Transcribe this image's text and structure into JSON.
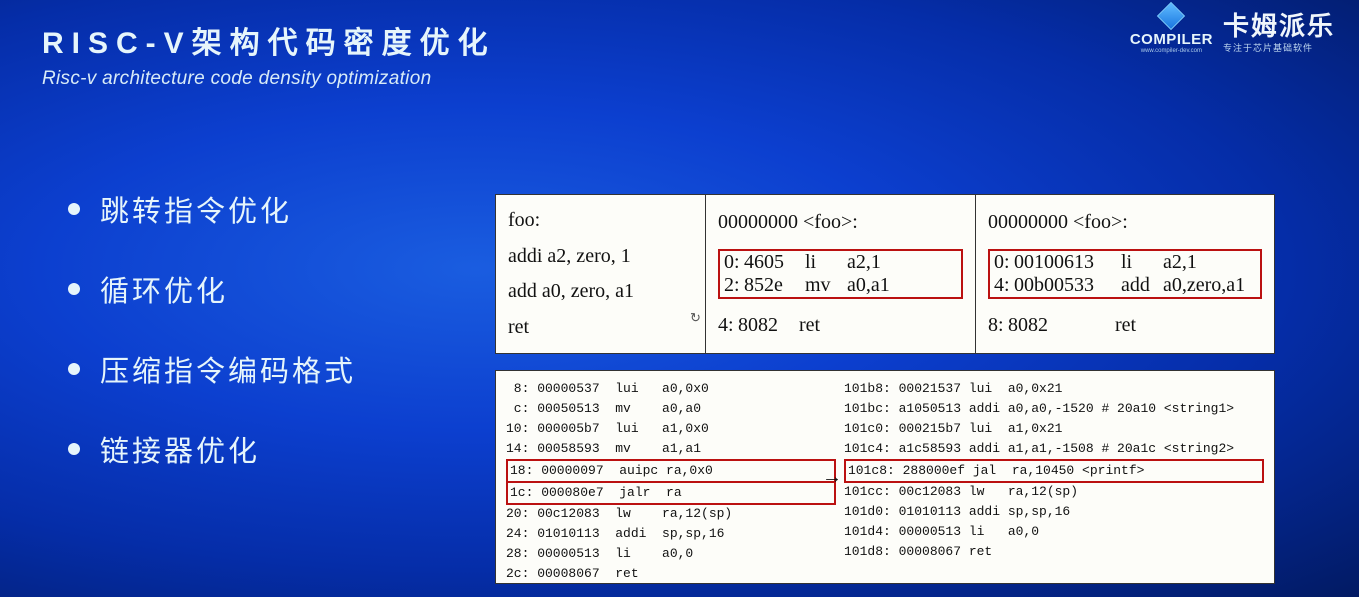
{
  "header": {
    "title_cn": "RISC-V架构代码密度优化",
    "title_en": "Risc-v architecture code density optimization"
  },
  "logo": {
    "compiler": "COMPILER",
    "compiler_sub": "www.compiler-dev.com",
    "brand": "卡姆派乐",
    "brand_sub": "专注于芯片基础软件"
  },
  "bullets": [
    "跳转指令优化",
    "循环优化",
    "压缩指令编码格式",
    "链接器优化"
  ],
  "panel1": {
    "col1": {
      "l1": "foo:",
      "l2": "addi a2, zero, 1",
      "l3": "add a0, zero, a1",
      "l4": "ret"
    },
    "col2": {
      "head": "00000000 <foo>:",
      "r1_addr": "0:",
      "r1_enc": "4605",
      "r1_mn": "li",
      "r1_ops": "a2,1",
      "r2_addr": "2:",
      "r2_enc": "852e",
      "r2_mn": "mv",
      "r2_ops": "a0,a1",
      "r3_addr": "4:",
      "r3_enc": "8082",
      "r3_mn": "ret",
      "r3_ops": ""
    },
    "col3": {
      "head": "00000000 <foo>:",
      "r1_addr": "0:",
      "r1_enc": "00100613",
      "r1_mn": "li",
      "r1_ops": "a2,1",
      "r2_addr": "4:",
      "r2_enc": "00b00533",
      "r2_mn": "add",
      "r2_ops": "a0,zero,a1",
      "r3_addr": "8:",
      "r3_enc": "8082",
      "r3_mn": "ret",
      "r3_ops": ""
    }
  },
  "panel2": {
    "left": [
      " 8: 00000537  lui   a0,0x0",
      " c: 00050513  mv    a0,a0",
      "10: 000005b7  lui   a1,0x0",
      "14: 00058593  mv    a1,a1",
      "18: 00000097  auipc ra,0x0",
      "1c: 000080e7  jalr  ra",
      "20: 00c12083  lw    ra,12(sp)",
      "24: 01010113  addi  sp,sp,16",
      "28: 00000513  li    a0,0",
      "2c: 00008067  ret"
    ],
    "left_box_start": 4,
    "left_box_end": 5,
    "right": [
      "101b8: 00021537 lui  a0,0x21",
      "101bc: a1050513 addi a0,a0,-1520 # 20a10 <string1>",
      "101c0: 000215b7 lui  a1,0x21",
      "101c4: a1c58593 addi a1,a1,-1508 # 20a1c <string2>",
      "101c8: 288000ef jal  ra,10450 <printf>",
      "101cc: 00c12083 lw   ra,12(sp)",
      "101d0: 01010113 addi sp,sp,16",
      "101d4: 00000513 li   a0,0",
      "101d8: 00008067 ret"
    ],
    "right_box_start": 4,
    "right_box_end": 4,
    "arrow": "→"
  },
  "reload_icon": "↻"
}
